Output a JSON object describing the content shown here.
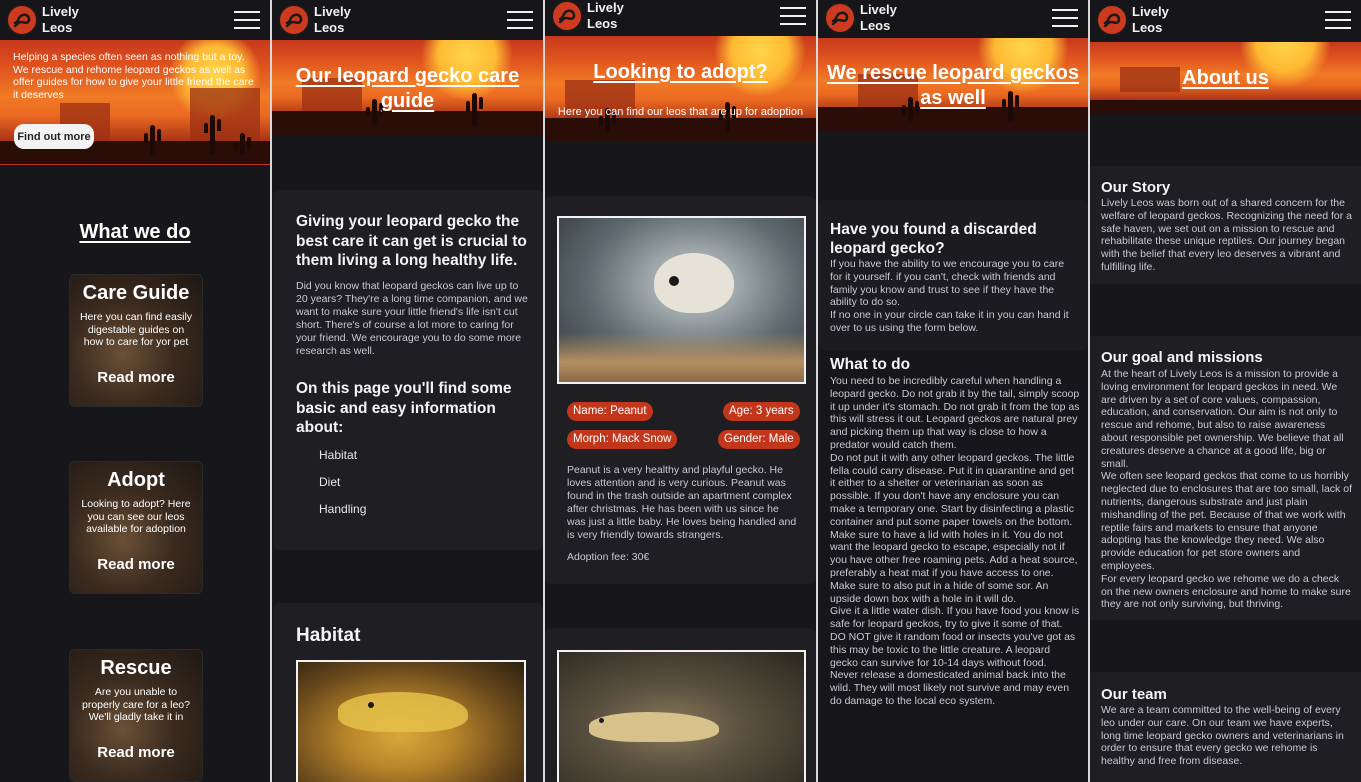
{
  "brand": {
    "line1": "Lively",
    "line2": "Leos"
  },
  "icons": {
    "logo": "gecko-logo-icon",
    "menu": "hamburger-menu-icon"
  },
  "colors": {
    "accent": "#c2371c",
    "background": "#17171b",
    "card": "#1e1e23"
  },
  "home": {
    "intro": "Helping a species often seen as nothing but a toy. We rescue and rehome leopard geckos as well as offer guides for how to give your little friend the care it deserves",
    "cta": "Find out more",
    "what_we_do": "What we do",
    "tiles": [
      {
        "title": "Care Guide",
        "desc": "Here you can find easily digestable guides on how to care for yor pet",
        "link": "Read more"
      },
      {
        "title": "Adopt",
        "desc": "Looking to adopt? Here you can see our leos available for adoption",
        "link": "Read more"
      },
      {
        "title": "Rescue",
        "desc": "Are you unable to properly care for a leo? We'll gladly take it in",
        "link": "Read more"
      }
    ]
  },
  "care": {
    "title": "Our leopard gecko care guide",
    "heading1": "Giving your leopard gecko the best care it can get is crucial to them living a long healthy life.",
    "para1": "Did you know that leopard geckos can live up to 20 years? They're a long time companion, and we want to make sure your little friend's life isn't cut short. There's of course a lot more to caring for your friend. We encourage you to do some more research as well.",
    "heading2": "On this page you'll find some basic and easy information about:",
    "topics": [
      "Habitat",
      "Diet",
      "Handling"
    ],
    "section_habitat": "Habitat"
  },
  "adopt": {
    "title": "Looking to adopt?",
    "subtitle": "Here you can find our leos that are up for adoption",
    "gecko": {
      "name": "Name: Peanut",
      "age": "Age: 3 years",
      "morph": "Morph: Mack Snow",
      "gender": "Gender: Male",
      "desc": "Peanut is a very healthy and playful gecko. He loves attention and is very curious. Peanut was found in the trash outside an apartment complex after christmas. He has been with us since he was just a little baby. He loves being handled and is very friendly towards strangers.",
      "fee": "Adoption fee: 30€"
    }
  },
  "rescue": {
    "title": "We rescue leopard geckos as well",
    "heading1": "Have you found a discarded leopard gecko?",
    "para1": "If you have the ability to we encourage you to care for it yourself. if you can't, check with friends and family you know and trust to see if they have the ability to do so.\nIf no one in your circle can take it in you can hand it over to us using the form below.",
    "heading2": "What to do",
    "para2": "You need to be incredibly careful when handling a leopard gecko. Do not grab it by the tail, simply scoop it up under it's stomach. Do not grab it from the top as this will stress it out. Leopard geckos are natural prey and picking them up that way is close to how a predator would catch them.\nDo not put it with any other leopard geckos. The little fella could carry disease. Put it in quarantine and get it either to a shelter or veterinarian as soon as possible. If you don't have any enclosure you can make a temporary one. Start by disinfecting a plastic container and put some paper towels on the bottom. Make sure to have a lid with holes in it. You do not want the leopard gecko to escape, especially not if you have other free roaming pets. Add a heat source, preferably a heat mat if you have access to one. Make sure to also put in a hide of some sor. An upside down box with a hole in it will do.\nGive it a little water dish. If you have food you know is safe for leopard geckos, try to give it some of that. DO NOT give it random food or insects you've got as this may be toxic to the little creature. A leopard gecko can survive for 10-14 days without food.\nNever release a domesticated animal back into the wild. They will most likely not survive and may even do damage to the local eco system."
  },
  "about": {
    "title": "About us",
    "story_h": "Our Story",
    "story": "Lively Leos was born out of a shared concern for the welfare of leopard geckos. Recognizing the need for a safe haven, we set out on a mission to rescue and rehabilitate these unique reptiles. Our journey began with the belief that every leo deserves a vibrant and fulfilling life.",
    "goal_h": "Our goal and missions",
    "goal": "At the heart of Lively Leos is a mission to provide a loving environment for leopard geckos in need. We are driven by a set of core values, compassion, education, and conservation. Our aim is not only to rescue and rehome, but also to raise awareness about responsible pet ownership. We believe that all creatures deserve a chance at a good life, big or small.\nWe often see leopard geckos that come to us horribly neglected due to enclosures that are too small, lack of nutrients, dangerous substrate and just plain mishandling of the pet. Because of that we work with reptile fairs and markets to ensure that anyone adopting has the knowledge they need. We also provide education for pet store owners and employees.\nFor every leopard gecko we rehome we do a check on the new owners enclosure and home to make sure they are not only surviving, but thriving.",
    "team_h": "Our team",
    "team": "We are a team committed to the well-being of every leo under our care. On our team we have experts, long time leopard gecko owners and veterinarians in order to ensure that every gecko we rehome is healthy and free from disease."
  }
}
